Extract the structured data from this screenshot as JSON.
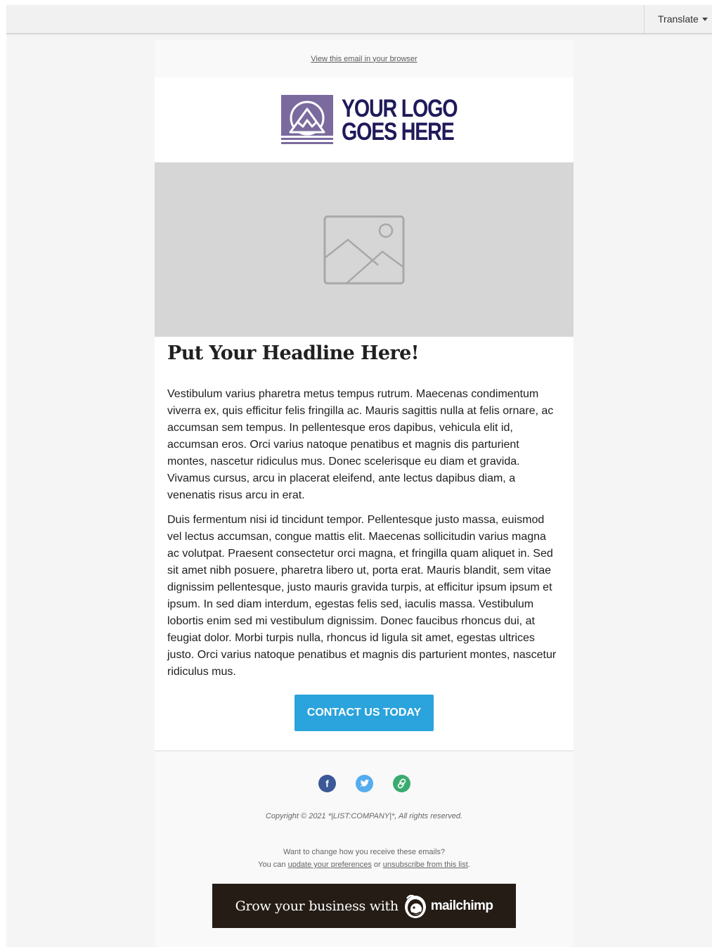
{
  "toolbar": {
    "translate_label": "Translate"
  },
  "email": {
    "preheader_link": "View this email in your browser",
    "logo": {
      "line1": "YOUR LOGO",
      "line2": "GOES HERE",
      "color": "#1f1a5a",
      "mark_color": "#7a6a9e"
    },
    "hero_icon": "image-placeholder-icon",
    "headline": "Put Your Headline Here!",
    "paragraphs": [
      "Vestibulum varius pharetra metus tempus rutrum. Maecenas condimentum viverra ex, quis efficitur felis fringilla ac. Mauris sagittis nulla at felis ornare, ac accumsan sem tempus. In pellentesque eros dapibus, vehicula elit id, accumsan eros. Orci varius natoque penatibus et magnis dis parturient montes, nascetur ridiculus mus. Donec scelerisque eu diam et gravida. Vivamus cursus, arcu in placerat eleifend, ante lectus dapibus diam, a venenatis risus arcu in erat.",
      "Duis fermentum nisi id tincidunt tempor. Pellentesque justo massa, euismod vel lectus accumsan, congue mattis elit. Maecenas sollicitudin varius magna ac volutpat. Praesent consectetur orci magna, et fringilla quam aliquet in. Sed sit amet nibh posuere, pharetra libero ut, porta erat. Mauris blandit, sem vitae dignissim pellentesque, justo mauris gravida turpis, at efficitur ipsum ipsum et ipsum. In sed diam interdum, egestas felis sed, iaculis massa. Vestibulum lobortis enim sed mi vestibulum dignissim. Donec faucibus rhoncus dui, at feugiat dolor. Morbi turpis nulla, rhoncus id ligula sit amet, egestas ultrices justo. Orci varius natoque penatibus et magnis dis parturient montes, nascetur ridiculus mus."
    ],
    "cta_label": "CONTACT US TODAY",
    "cta_color": "#2ba3dc"
  },
  "footer": {
    "social": [
      {
        "name": "facebook-icon",
        "glyph": "f",
        "color": "#3b5998"
      },
      {
        "name": "twitter-icon",
        "glyph": "t",
        "color": "#55acee"
      },
      {
        "name": "link-icon",
        "glyph": "link",
        "color": "#3aaa70"
      }
    ],
    "copyright": "Copyright © 2021 *|LIST:COMPANY|*, All rights reserved.",
    "prefs_line1": "Want to change how you receive these emails?",
    "prefs_you_can": "You can",
    "prefs_update_link": "update your preferences",
    "prefs_or": "or",
    "prefs_unsubscribe_link": "unsubscribe from this list",
    "prefs_period": ".",
    "mailchimp_text": "Grow your business with",
    "mailchimp_brand": "mailchimp",
    "mailchimp_bg": "#241c15"
  }
}
